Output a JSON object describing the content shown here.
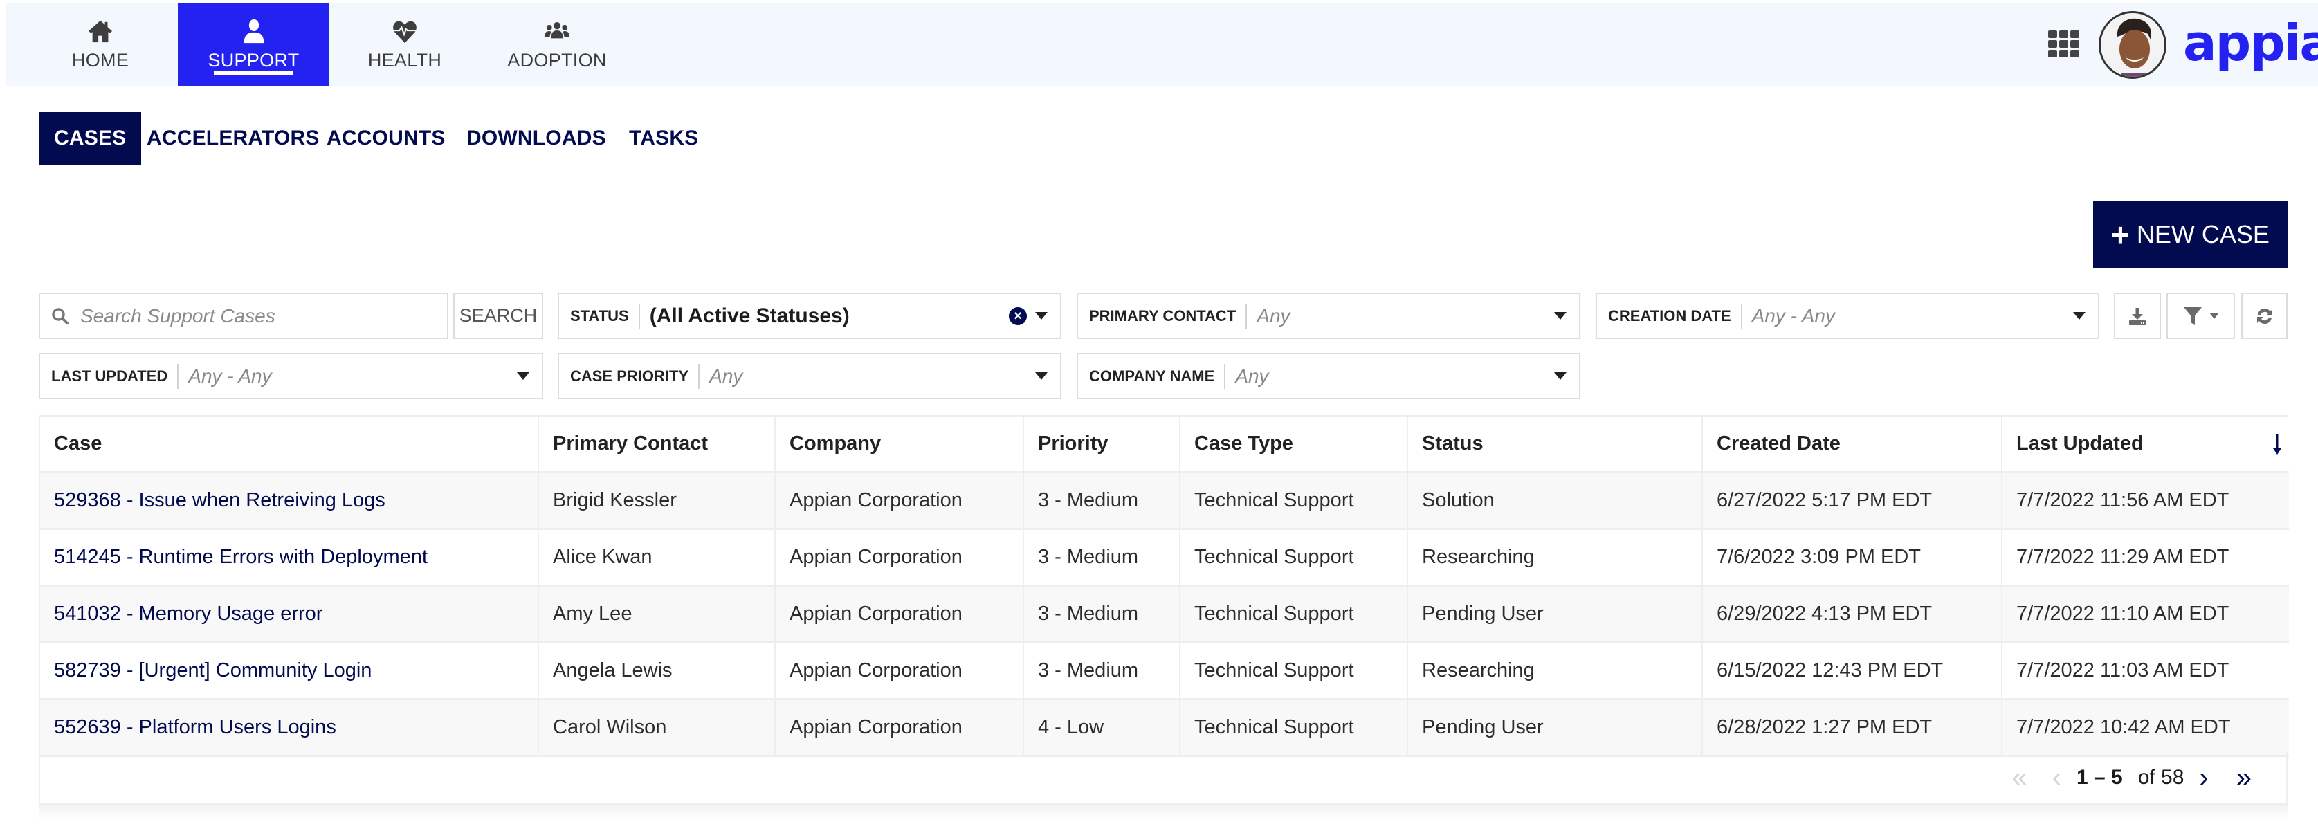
{
  "top_nav": {
    "items": [
      {
        "label": "HOME",
        "icon": "home-icon",
        "active": false
      },
      {
        "label": "SUPPORT",
        "icon": "user-icon",
        "active": true
      },
      {
        "label": "HEALTH",
        "icon": "heartbeat-icon",
        "active": false
      },
      {
        "label": "ADOPTION",
        "icon": "users-icon",
        "active": false
      }
    ],
    "apps_icon": "grid-icon",
    "avatar_alt": "User avatar",
    "logo_text": "appian"
  },
  "sub_tabs": [
    {
      "label": "CASES",
      "active": true
    },
    {
      "label": "ACCELERATORS",
      "active": false
    },
    {
      "label": "ACCOUNTS",
      "active": false
    },
    {
      "label": "DOWNLOADS",
      "active": false
    },
    {
      "label": "TASKS",
      "active": false
    }
  ],
  "actions": {
    "new_case_label": "NEW CASE",
    "new_case_icon": "plus-icon"
  },
  "search": {
    "placeholder": "Search Support Cases",
    "value": "",
    "button_label": "SEARCH"
  },
  "filters": {
    "status": {
      "label": "STATUS",
      "value": "(All Active Statuses)"
    },
    "primary_contact": {
      "label": "PRIMARY CONTACT",
      "value": "Any"
    },
    "creation_date": {
      "label": "CREATION DATE",
      "value": "Any - Any"
    },
    "last_updated": {
      "label": "LAST UPDATED",
      "value": "Any - Any"
    },
    "case_priority": {
      "label": "CASE PRIORITY",
      "value": "Any"
    },
    "company_name": {
      "label": "COMPANY NAME",
      "value": "Any"
    }
  },
  "toolbar_icons": [
    "download-icon",
    "filter-icon",
    "refresh-icon"
  ],
  "table": {
    "columns": [
      "Case",
      "Primary Contact",
      "Company",
      "Priority",
      "Case Type",
      "Status",
      "Created Date",
      "Last Updated"
    ],
    "sorted_column": "Last Updated",
    "sort_direction": "descending",
    "rows": [
      [
        "529368 - Issue when Retreiving Logs",
        "Brigid Kessler",
        "Appian Corporation",
        "3 - Medium",
        "Technical Support",
        "Solution",
        "6/27/2022 5:17 PM EDT",
        "7/7/2022 11:56 AM EDT"
      ],
      [
        "514245 - Runtime Errors with Deployment",
        "Alice Kwan",
        "Appian Corporation",
        "3 - Medium",
        "Technical Support",
        "Researching",
        "7/6/2022 3:09 PM EDT",
        "7/7/2022 11:29 AM EDT"
      ],
      [
        "541032 - Memory Usage error",
        "Amy Lee",
        "Appian Corporation",
        "3 - Medium",
        "Technical Support",
        "Pending User",
        "6/29/2022 4:13 PM EDT",
        "7/7/2022 11:10 AM EDT"
      ],
      [
        "582739 - [Urgent] Community Login",
        "Angela Lewis",
        "Appian Corporation",
        "3 - Medium",
        "Technical Support",
        "Researching",
        "6/15/2022 12:43 PM EDT",
        "7/7/2022 11:03 AM EDT"
      ],
      [
        "552639 - Platform Users Logins",
        "Carol Wilson",
        "Appian Corporation",
        "4 - Low",
        "Technical Support",
        "Pending User",
        "6/28/2022 1:27 PM EDT",
        "7/7/2022 10:42 AM EDT"
      ]
    ]
  },
  "pagination": {
    "range": "1 – 5",
    "total": "of 58",
    "first_glyph": "«",
    "prev_glyph": "‹",
    "next_glyph": "›",
    "last_glyph": "»"
  },
  "colors": {
    "brand_blue": "#2322f0",
    "navy": "#020a50",
    "nav_bg": "#f3f8ff"
  }
}
